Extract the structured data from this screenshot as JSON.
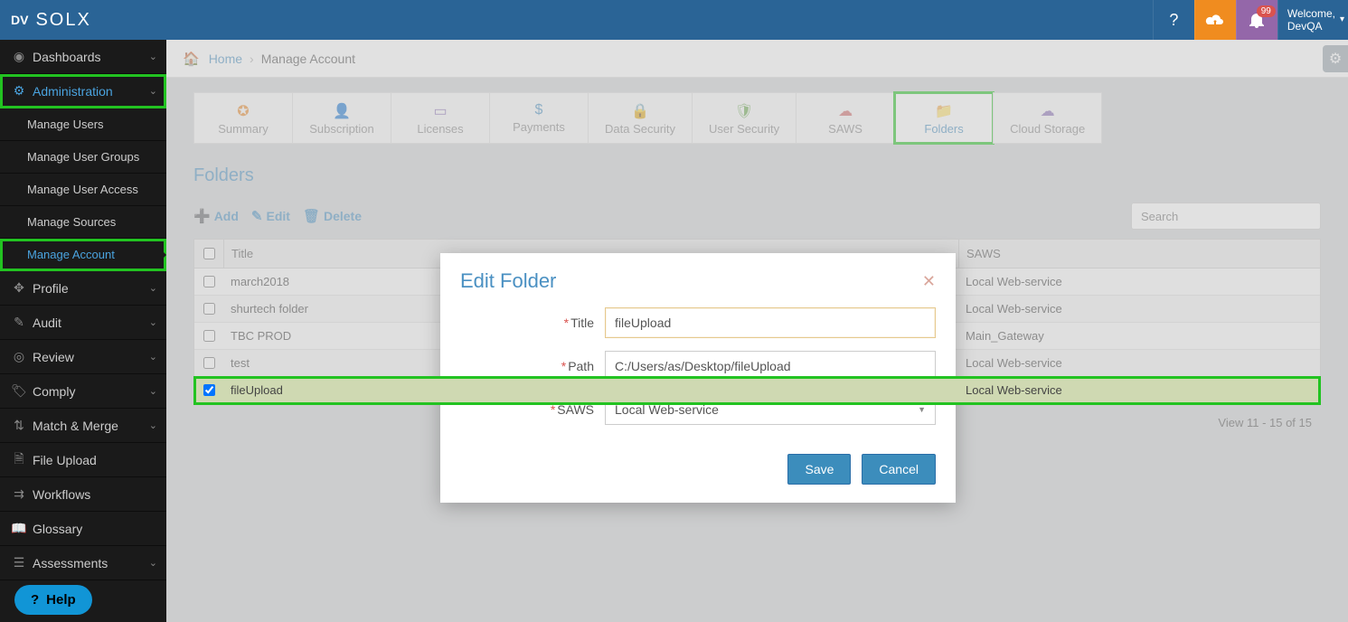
{
  "brand": {
    "logo_prefix": "DV",
    "name": "SOLX"
  },
  "topbar": {
    "badge": "99",
    "welcome_line1": "Welcome,",
    "welcome_user": "DevQA"
  },
  "sidebar": {
    "items": [
      {
        "icon": "dashboard",
        "label": "Dashboards",
        "expandable": true
      },
      {
        "icon": "gears",
        "label": "Administration",
        "expandable": true,
        "active": true,
        "hl": true
      }
    ],
    "admin_sub": [
      {
        "label": "Manage Users"
      },
      {
        "label": "Manage User Groups"
      },
      {
        "label": "Manage User Access"
      },
      {
        "label": "Manage Sources"
      },
      {
        "label": "Manage Account",
        "active": true,
        "hl": true
      }
    ],
    "rest": [
      {
        "icon": "move",
        "label": "Profile",
        "expandable": true
      },
      {
        "icon": "edit",
        "label": "Audit",
        "expandable": true
      },
      {
        "icon": "target",
        "label": "Review",
        "expandable": true
      },
      {
        "icon": "tag",
        "label": "Comply",
        "expandable": true
      },
      {
        "icon": "merge",
        "label": "Match & Merge",
        "expandable": true
      },
      {
        "icon": "file",
        "label": "File Upload"
      },
      {
        "icon": "flow",
        "label": "Workflows"
      },
      {
        "icon": "book",
        "label": "Glossary"
      },
      {
        "icon": "list",
        "label": "Assessments",
        "expandable": true
      }
    ],
    "help": "Help"
  },
  "breadcrumb": {
    "home": "Home",
    "current": "Manage Account"
  },
  "tabs": [
    {
      "label": "Summary",
      "color": "orange"
    },
    {
      "label": "Subscription",
      "color": "orange"
    },
    {
      "label": "Licenses",
      "color": "purple"
    },
    {
      "label": "Payments",
      "color": "blue"
    },
    {
      "label": "Data Security",
      "color": "orange"
    },
    {
      "label": "User Security",
      "color": "green"
    },
    {
      "label": "SAWS",
      "color": "red"
    },
    {
      "label": "Folders",
      "color": "blue",
      "active": true,
      "hl": true
    },
    {
      "label": "Cloud Storage",
      "color": "purple"
    }
  ],
  "section_title": "Folders",
  "toolbar": {
    "add": "Add",
    "edit": "Edit",
    "delete": "Delete",
    "search_placeholder": "Search"
  },
  "table": {
    "headers": {
      "title": "Title",
      "saws": "SAWS"
    },
    "rows": [
      {
        "title": "march2018",
        "saws": "Local Web-service",
        "checked": false
      },
      {
        "title": "shurtech folder",
        "saws": "Local Web-service",
        "checked": false
      },
      {
        "title": "TBC PROD",
        "saws": "Main_Gateway",
        "checked": false
      },
      {
        "title": "test",
        "saws": "Local Web-service",
        "checked": false
      },
      {
        "title": "fileUpload",
        "saws": "Local Web-service",
        "checked": true,
        "selected": true,
        "hl": true
      }
    ],
    "pager": "View 11 - 15 of 15"
  },
  "modal": {
    "title": "Edit Folder",
    "fields": {
      "title": {
        "label": "Title",
        "value": "fileUpload",
        "required": true
      },
      "path": {
        "label": "Path",
        "value": "C:/Users/as/Desktop/fileUpload",
        "required": true
      },
      "saws": {
        "label": "SAWS",
        "value": "Local Web-service",
        "required": true
      }
    },
    "save": "Save",
    "cancel": "Cancel"
  }
}
